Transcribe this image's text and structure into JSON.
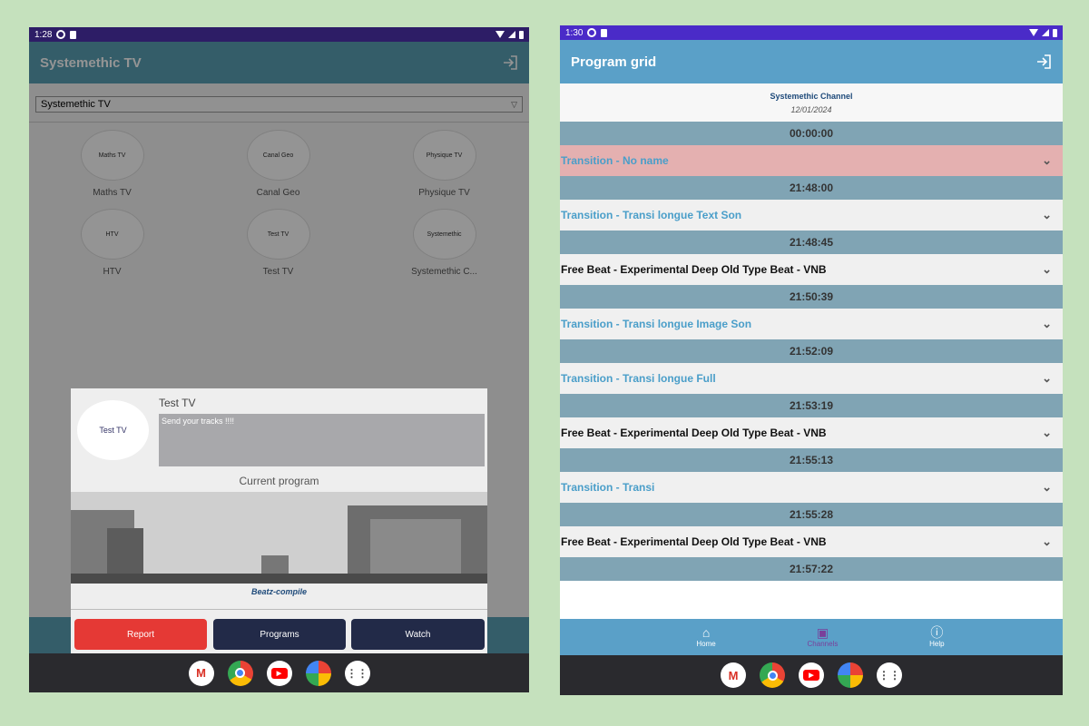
{
  "left": {
    "status_time": "1:28",
    "app_title": "Systemethic TV",
    "select_value": "Systemethic TV",
    "channels": [
      {
        "name": "Maths TV",
        "logo_text": "Maths TV"
      },
      {
        "name": "Canal Geo",
        "logo_text": "Canal Geo"
      },
      {
        "name": "Physique TV",
        "logo_text": "Physique TV"
      },
      {
        "name": "HTV",
        "logo_text": "HTV"
      },
      {
        "name": "Test TV",
        "logo_text": "Test TV"
      },
      {
        "name": "Systemethic C...",
        "logo_text": "Systemethic"
      }
    ],
    "dialog": {
      "channel_name": "Test TV",
      "logo_text": "Test TV",
      "description": "Send your tracks !!!!",
      "current_program_label": "Current program",
      "program_title": "Beatz-compile",
      "report_label": "Report",
      "programs_label": "Programs",
      "watch_label": "Watch"
    }
  },
  "right": {
    "status_time": "1:30",
    "app_title": "Program grid",
    "channel_name": "Systemethic Channel",
    "date": "12/01/2024",
    "schedule": [
      {
        "time": "00:00:00",
        "title": "Transition - No name",
        "kind": "transition",
        "highlight": true
      },
      {
        "time": "21:48:00",
        "title": "Transition - Transi longue Text Son",
        "kind": "transition"
      },
      {
        "time": "21:48:45",
        "title": "Free Beat -  Experimental Deep Old Type Beat - VNB",
        "kind": "beat"
      },
      {
        "time": "21:50:39",
        "title": "Transition - Transi longue Image Son",
        "kind": "transition"
      },
      {
        "time": "21:52:09",
        "title": "Transition - Transi longue Full",
        "kind": "transition"
      },
      {
        "time": "21:53:19",
        "title": "Free Beat -  Experimental Deep Old Type Beat - VNB",
        "kind": "beat"
      },
      {
        "time": "21:55:13",
        "title": "Transition - Transi",
        "kind": "transition"
      },
      {
        "time": "21:55:28",
        "title": "Free Beat -  Experimental Deep Old Type Beat - VNB",
        "kind": "beat"
      },
      {
        "time": "21:57:22",
        "title": null,
        "kind": "end"
      }
    ],
    "bottom_nav": [
      {
        "label": "Home",
        "icon": "home-icon",
        "active": false
      },
      {
        "label": "Channels",
        "icon": "tv-icon",
        "active": true
      },
      {
        "label": "Help",
        "icon": "help-icon",
        "active": false
      }
    ]
  },
  "dock_apps": [
    "gmail-icon",
    "chrome-icon",
    "youtube-icon",
    "photos-icon",
    "apps-icon"
  ]
}
